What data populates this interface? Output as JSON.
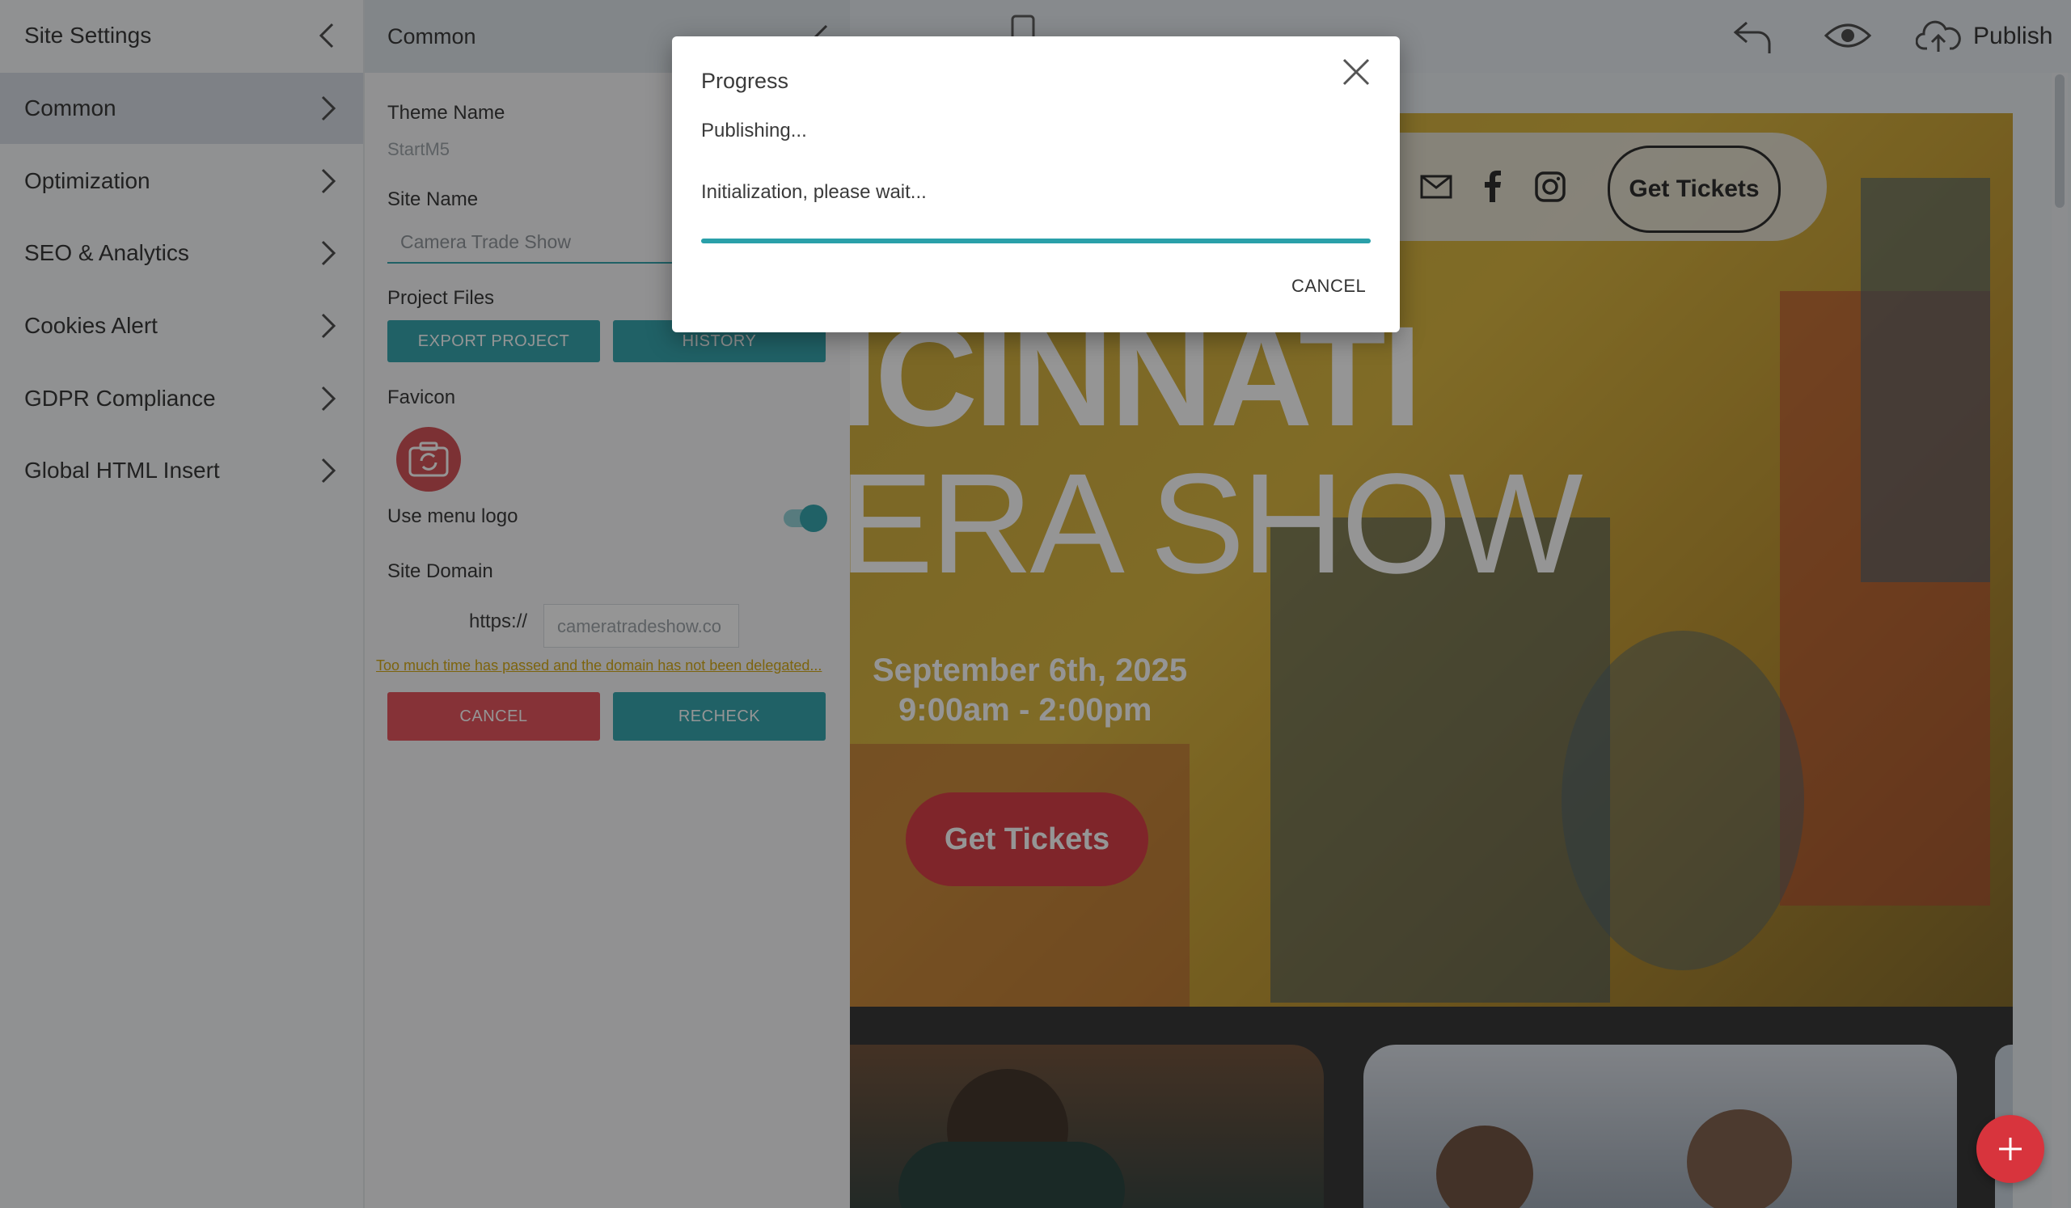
{
  "nav": {
    "header": "Site Settings",
    "items": [
      {
        "label": "Common"
      },
      {
        "label": "Optimization"
      },
      {
        "label": "SEO & Analytics"
      },
      {
        "label": "Cookies Alert"
      },
      {
        "label": "GDPR Compliance"
      },
      {
        "label": "Global HTML Insert"
      }
    ]
  },
  "panel": {
    "title": "Common",
    "theme_name_label": "Theme Name",
    "theme_name_value": "StartM5",
    "site_name_label": "Site Name",
    "site_name_value": "Camera Trade Show",
    "project_files_label": "Project Files",
    "export_label": "EXPORT PROJECT",
    "history_label": "HISTORY",
    "favicon_label": "Favicon",
    "use_menu_logo_label": "Use menu logo",
    "use_menu_logo_on": true,
    "site_domain_label": "Site Domain",
    "protocol": "https://",
    "domain_value": "cameratradeshow.co",
    "warning": "Too much time has passed and the domain has not been delegated...",
    "cancel_label": "CANCEL",
    "recheck_label": "RECHECK"
  },
  "topbar": {
    "publish_label": "Publish"
  },
  "preview": {
    "nav_button": "Get Tickets",
    "title_line1": "ICINNATI",
    "title_line2": "ERA SHOW",
    "date": "September 6th, 2025",
    "time": "9:00am - 2:00pm",
    "cta": "Get Tickets"
  },
  "dialog": {
    "title": "Progress",
    "status": "Publishing...",
    "message": "Initialization, please wait...",
    "progress_percent": 100,
    "cancel_label": "CANCEL"
  },
  "colors": {
    "accent_teal": "#2aa0a9",
    "danger_red": "#e34b54",
    "warning_text": "#d4a60a"
  }
}
